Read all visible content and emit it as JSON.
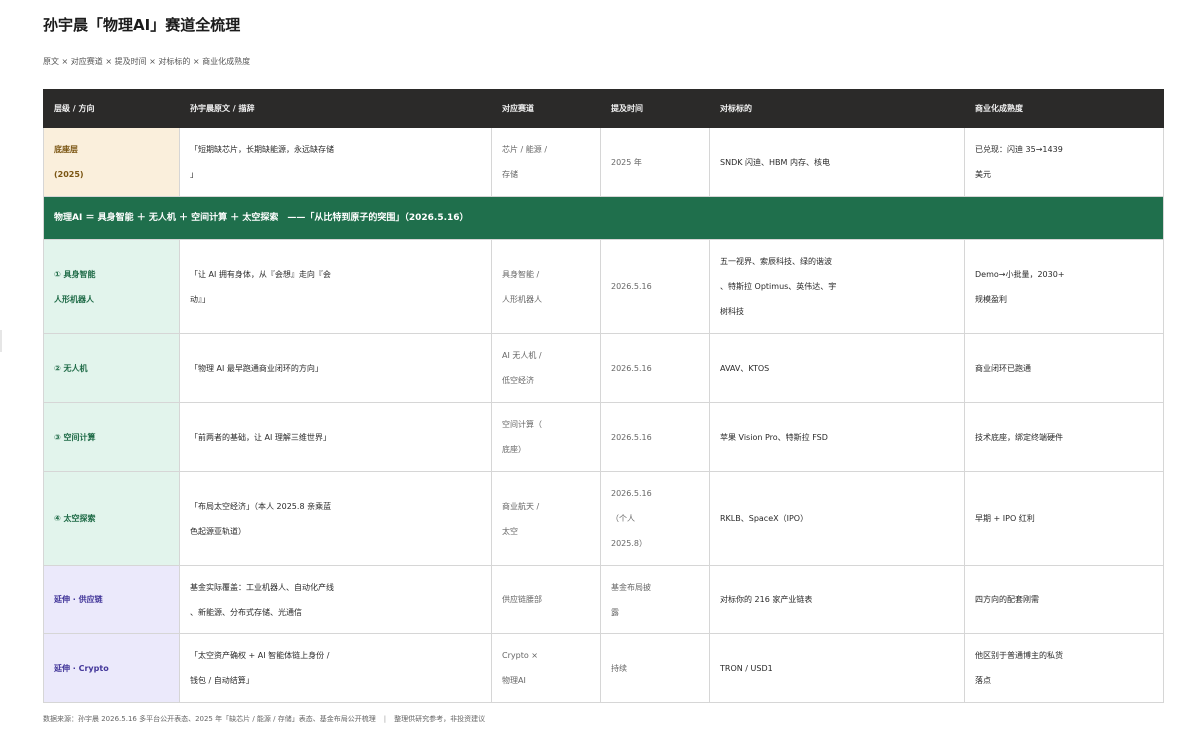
{
  "page": {
    "title": "孙宇晨「物理AI」赛道全梳理",
    "subtitle": "原文 × 对应赛道 × 提及时间 × 对标标的 × 商业化成熟度"
  },
  "table": {
    "headers": [
      "层级 / 方向",
      "孙宇晨原文 / 描辞",
      "对应赛道",
      "提及时间",
      "对标标的",
      "商业化成熟度"
    ],
    "base_row": {
      "level": "底座层\n(2025)",
      "quote": "「短期缺芯片，长期缺能源，永远缺存储\n」",
      "track": "芯片 / 能源 /\n存储",
      "date": "2025 年",
      "targets": "SNDK 闪迪、HBM 内存、核电",
      "maturity": "已兑现：闪迪 35→1439\n美元"
    },
    "banner": "物理AI ＝ 具身智能 ＋ 无人机 ＋ 空间计算 ＋ 太空探索　——「从比特到原子的突围」（2026.5.16）",
    "rows": [
      {
        "level": "① 具身智能\n人形机器人",
        "quote": "「让 AI 拥有身体，从『会想』走向『会\n动』」",
        "track": "具身智能 /\n人形机器人",
        "date": "2026.5.16",
        "targets": "五一视界、索辰科技、绿的谐波\n、特斯拉 Optimus、英伟达、宇\n树科技",
        "maturity": "Demo→小批量，2030+\n规模盈利"
      },
      {
        "level": "② 无人机",
        "quote": "「物理 AI 最早跑通商业闭环的方向」",
        "track": "AI 无人机 /\n低空经济",
        "date": "2026.5.16",
        "targets": "AVAV、KTOS",
        "maturity": "商业闭环已跑通"
      },
      {
        "level": "③ 空间计算",
        "quote": "「前两者的基础，让 AI 理解三维世界」",
        "track": "空间计算（\n底座）",
        "date": "2026.5.16",
        "targets": "苹果 Vision Pro、特斯拉 FSD",
        "maturity": "技术底座，绑定终端硬件"
      },
      {
        "level": "④ 太空探索",
        "quote": "「布局太空经济」（本人 2025.8 亲乘蓝\n色起源亚轨道）",
        "track": "商业航天 /\n太空",
        "date": "2026.5.16\n（个人\n2025.8）",
        "targets": "RKLB、SpaceX（IPO）",
        "maturity": "早期 + IPO 红利"
      }
    ],
    "ext_rows": [
      {
        "level": "延伸 · 供应链",
        "quote": "基金实际覆盖：工业机器人、自动化产线\n、新能源、分布式存储、光通信",
        "track": "供应链腰部",
        "date": "基金布局披\n露",
        "targets": "对标你的 216 家产业链表",
        "maturity": "四方向的配套刚需"
      },
      {
        "level": "延伸 · Crypto",
        "quote": "「太空资产确权 + AI 智能体链上身份 /\n钱包 / 自动结算」",
        "track": "Crypto ×\n物理AI",
        "date": "持续",
        "targets": "TRON / USD1",
        "maturity": "他区别于普通博主的私货\n落点"
      }
    ]
  },
  "footer": {
    "source": "数据来源：孙宇晨 2026.5.16 多平台公开表态、2025 年「缺芯片 / 能源 / 存储」表态、基金布局公开梳理",
    "separator": "|",
    "note": "整理供研究参考，非投资建议"
  }
}
